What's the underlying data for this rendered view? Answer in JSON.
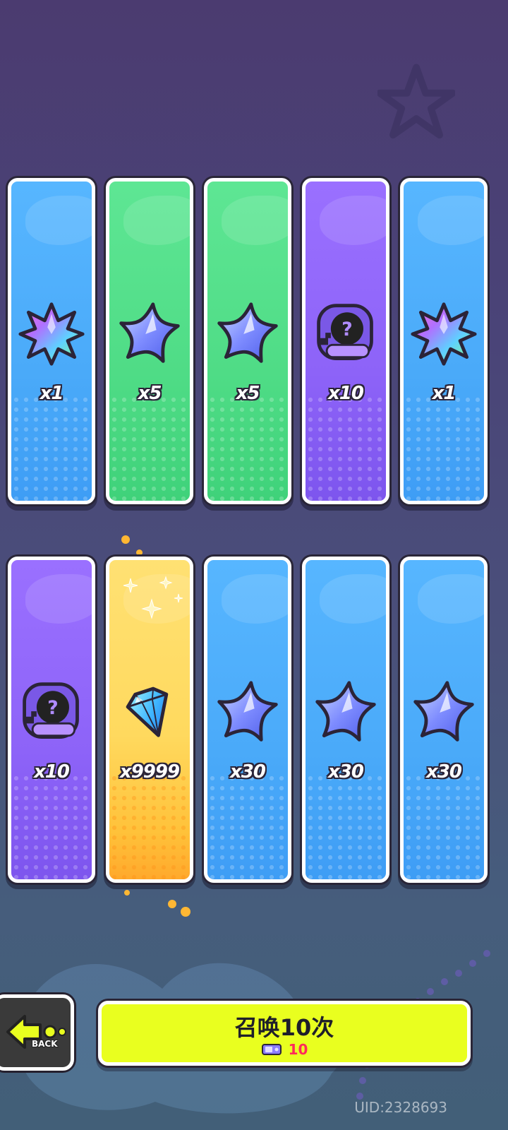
{
  "colors": {
    "blue": "#4aaaf9",
    "green": "#4fdc86",
    "purple": "#8d63f8",
    "gold": "#ffd95e",
    "summon_button": "#e9ff1f",
    "cost_text": "#ff2a5a"
  },
  "rewards": [
    {
      "rarity": "blue",
      "icon": "rainbow-leaf-icon",
      "quantity": "x1"
    },
    {
      "rarity": "green",
      "icon": "blue-star-icon",
      "quantity": "x5"
    },
    {
      "rarity": "green",
      "icon": "blue-star-icon",
      "quantity": "x5"
    },
    {
      "rarity": "purple",
      "icon": "mystery-deity-icon",
      "quantity": "x10"
    },
    {
      "rarity": "blue",
      "icon": "rainbow-leaf-icon",
      "quantity": "x1"
    },
    {
      "rarity": "purple",
      "icon": "mystery-deity-icon",
      "quantity": "x10"
    },
    {
      "rarity": "gold",
      "icon": "diamond-icon",
      "quantity": "x9999"
    },
    {
      "rarity": "blue",
      "icon": "blue-star-icon",
      "quantity": "x30"
    },
    {
      "rarity": "blue",
      "icon": "blue-star-icon",
      "quantity": "x30"
    },
    {
      "rarity": "blue",
      "icon": "blue-star-icon",
      "quantity": "x30"
    }
  ],
  "back_button": {
    "label": "BACK",
    "icon": "back-arrow-icon"
  },
  "summon_button": {
    "label": "召唤10次",
    "cost_icon": "ticket-icon",
    "cost": "10"
  },
  "uid": "UID:2328693"
}
